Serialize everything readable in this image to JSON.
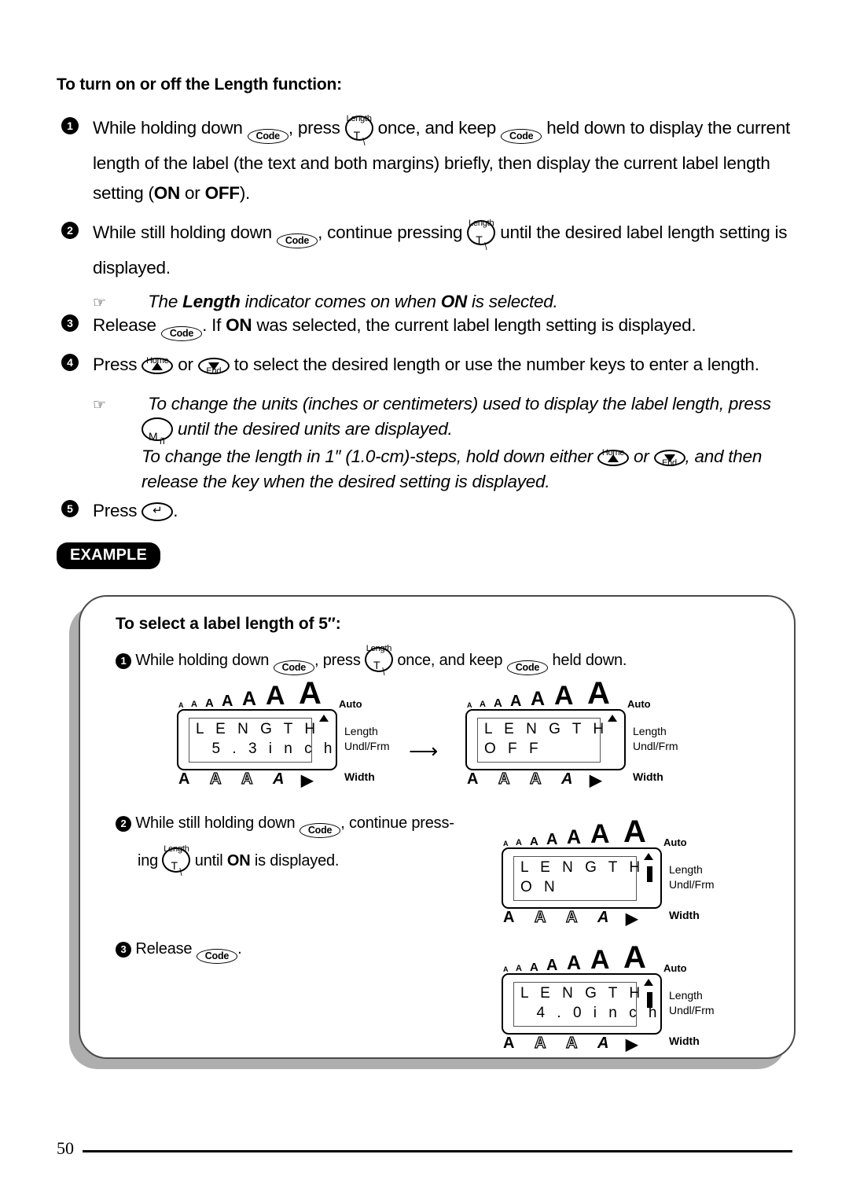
{
  "section": {
    "heading": "To turn on or off the Length function:"
  },
  "steps": [
    {
      "num": "1",
      "parts": [
        "While holding down ",
        "Code",
        ", press ",
        "T-key",
        " once, and keep ",
        "Code",
        " held down to display the current length of the label (the text and both margins) briefly, then display the current label length setting (",
        "ON",
        " or ",
        "OFF",
        ")."
      ]
    },
    {
      "num": "2",
      "parts": [
        "While still holding down ",
        "Code",
        ", continue pressing ",
        "T-key",
        " until the desired label length setting is displayed."
      ]
    },
    {
      "num": "3",
      "parts": [
        "Release ",
        "Code",
        ". If ",
        "ON",
        " was selected, the current label length setting is displayed."
      ]
    },
    {
      "num": "4",
      "parts": [
        "Press ",
        "up-key",
        " or ",
        "down-key",
        " to select the desired length or use the number keys to enter a length."
      ]
    },
    {
      "num": "5",
      "parts": [
        "Press ",
        "enter-key",
        "."
      ]
    }
  ],
  "notes": {
    "note1": {
      "pre": "The ",
      "bold": "Length",
      "mid": " indicator comes on when ",
      "bold2": "ON",
      "post": " is selected."
    },
    "note2_line1": "To change the units (inches or centimeters) used to display the label length, press",
    "note2_line2": " until the desired units are displayed.",
    "note2_line3a": "To change the length in 1″ (1.0-cm)-steps, hold down either ",
    "note2_line3b": " or ",
    "note2_line3c": ", and then",
    "note2_line4": "release the key when the desired setting is displayed."
  },
  "example": {
    "badge": "EXAMPLE",
    "title": "To select a label length of 5″:",
    "steps": [
      {
        "num": "1",
        "t1": "While holding down ",
        "t2": ", press ",
        "t3": " once, and keep ",
        "t4": " held down."
      },
      {
        "num": "2",
        "t1": "While still holding down ",
        "t2": ", continue press-",
        "t3": "ing ",
        "t4": " until ",
        "t5": "ON",
        "t6": " is displayed."
      },
      {
        "num": "3",
        "t1": "Release ",
        "t2": "."
      }
    ]
  },
  "keys": {
    "code": "Code",
    "t_top": "Length",
    "t_face": "T",
    "t_slash": "\\",
    "home": "Home",
    "end": "End",
    "m": "M",
    "n": "ñ",
    "enter": "↵"
  },
  "lcd_common": {
    "auto": "Auto",
    "width": "Width",
    "right_line1": "Length",
    "right_line2": "Undl/Frm",
    "size_glyphs": [
      "A",
      "A",
      "A",
      "A",
      "A",
      "A",
      "A"
    ],
    "bottom_glyphs": [
      "A",
      "A",
      "A",
      "A",
      "◀"
    ]
  },
  "lcds": [
    {
      "id": "lcd-length-5-3-inch",
      "line1": "L E N G T H",
      "line2": "  5 . 3 i n c h",
      "indicator": "triangle"
    },
    {
      "id": "lcd-length-off",
      "line1": "L E N G T H",
      "line2": "O F F",
      "indicator": "triangle"
    },
    {
      "id": "lcd-length-on",
      "line1": "L E N G T H",
      "line2": "O N",
      "indicator": "bar"
    },
    {
      "id": "lcd-length-4-0-inch",
      "line1": "L E N G T H",
      "line2": "  4 . 0 i n c h",
      "indicator": "bar"
    }
  ],
  "transition_arrow": "⟶",
  "footer": {
    "page_number": "50"
  }
}
